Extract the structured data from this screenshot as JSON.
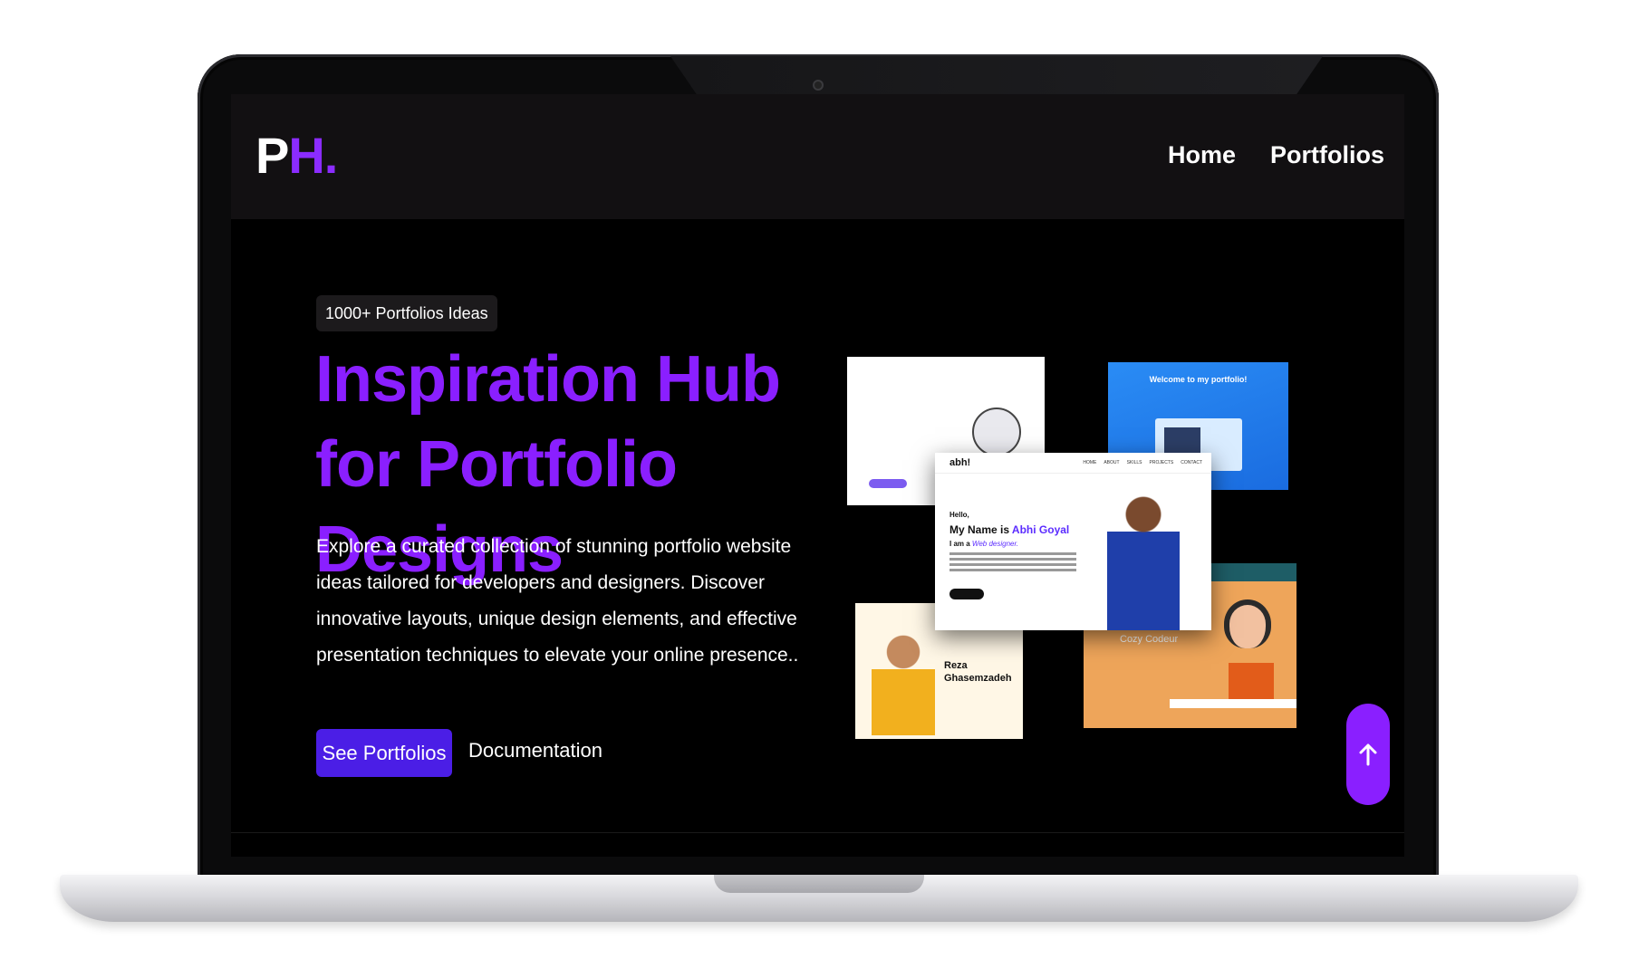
{
  "nav": {
    "logo_p": "P",
    "logo_h": "H.",
    "links": [
      "Home",
      "Portfolios"
    ]
  },
  "hero": {
    "badge": "1000+ Portfolios Ideas",
    "title": "Inspiration Hub for Portfolio Designs",
    "description": "Explore a curated collection of stunning portfolio website ideas tailored for developers and designers. Discover innovative layouts, unique design elements, and effective presentation techniques to elevate your online presence..",
    "primary_button": "See Portfolios",
    "secondary_button": "Documentation"
  },
  "collage": {
    "card_main": {
      "brand": "abh!",
      "menu": [
        "HOME",
        "ABOUT",
        "SKILLS",
        "PROJECTS",
        "CONTACT"
      ],
      "hello": "Hello,",
      "name_prefix": "My Name is",
      "name": "Abhi Goyal",
      "role_prefix": "I am a",
      "role": "Web designer."
    },
    "card_b": {
      "welcome": "Welcome to my portfolio!"
    },
    "card_c": {
      "name": "Reza Ghasemzadeh"
    },
    "card_d": {
      "title": "Cozy Codeur"
    }
  },
  "scroll_top": {
    "icon": "arrow-up-icon"
  },
  "colors": {
    "accent": "#8a1fff",
    "button": "#4b1ee6",
    "background": "#000000"
  }
}
